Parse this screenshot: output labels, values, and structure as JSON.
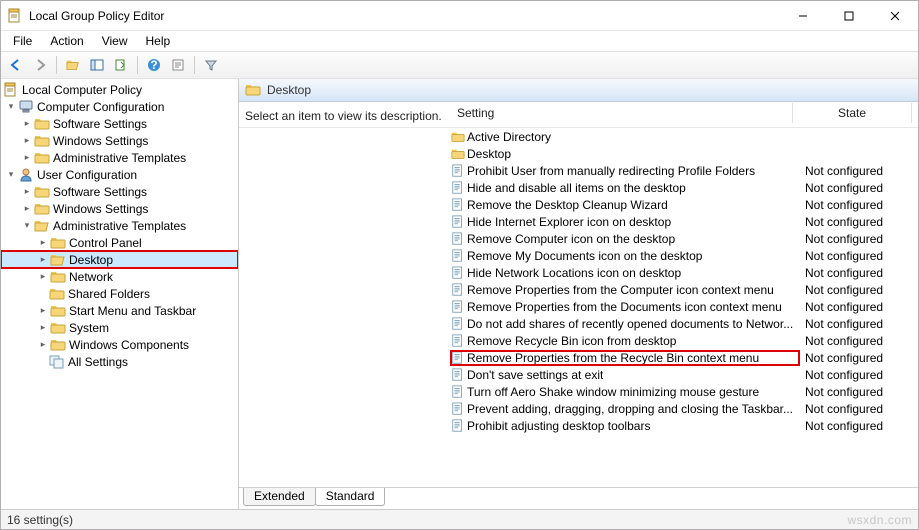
{
  "window": {
    "title": "Local Group Policy Editor"
  },
  "menubar": {
    "items": [
      "File",
      "Action",
      "View",
      "Help"
    ]
  },
  "tree": {
    "root": "Local Computer Policy",
    "computer_config": "Computer Configuration",
    "cc_software": "Software Settings",
    "cc_windows": "Windows Settings",
    "cc_admin": "Administrative Templates",
    "user_config": "User Configuration",
    "uc_software": "Software Settings",
    "uc_windows": "Windows Settings",
    "uc_admin": "Administrative Templates",
    "control_panel": "Control Panel",
    "desktop": "Desktop",
    "network": "Network",
    "shared": "Shared Folders",
    "startmenu": "Start Menu and Taskbar",
    "system": "System",
    "wincomp": "Windows Components",
    "allsettings": "All Settings"
  },
  "details": {
    "crumb": "Desktop",
    "description_prompt": "Select an item to view its description.",
    "col_setting": "Setting",
    "col_state": "State",
    "items": [
      {
        "type": "folder",
        "name": "Active Directory",
        "state": ""
      },
      {
        "type": "folder",
        "name": "Desktop",
        "state": ""
      },
      {
        "type": "policy",
        "name": "Prohibit User from manually redirecting Profile Folders",
        "state": "Not configured"
      },
      {
        "type": "policy",
        "name": "Hide and disable all items on the desktop",
        "state": "Not configured"
      },
      {
        "type": "policy",
        "name": "Remove the Desktop Cleanup Wizard",
        "state": "Not configured"
      },
      {
        "type": "policy",
        "name": "Hide Internet Explorer icon on desktop",
        "state": "Not configured"
      },
      {
        "type": "policy",
        "name": "Remove Computer icon on the desktop",
        "state": "Not configured"
      },
      {
        "type": "policy",
        "name": "Remove My Documents icon on the desktop",
        "state": "Not configured"
      },
      {
        "type": "policy",
        "name": "Hide Network Locations icon on desktop",
        "state": "Not configured"
      },
      {
        "type": "policy",
        "name": "Remove Properties from the Computer icon context menu",
        "state": "Not configured"
      },
      {
        "type": "policy",
        "name": "Remove Properties from the Documents icon context menu",
        "state": "Not configured"
      },
      {
        "type": "policy",
        "name": "Do not add shares of recently opened documents to Networ...",
        "state": "Not configured"
      },
      {
        "type": "policy",
        "name": "Remove Recycle Bin icon from desktop",
        "state": "Not configured"
      },
      {
        "type": "policy",
        "name": "Remove Properties from the Recycle Bin context menu",
        "state": "Not configured",
        "highlight": true
      },
      {
        "type": "policy",
        "name": "Don't save settings at exit",
        "state": "Not configured"
      },
      {
        "type": "policy",
        "name": "Turn off Aero Shake window minimizing mouse gesture",
        "state": "Not configured"
      },
      {
        "type": "policy",
        "name": "Prevent adding, dragging, dropping and closing the Taskbar...",
        "state": "Not configured"
      },
      {
        "type": "policy",
        "name": "Prohibit adjusting desktop toolbars",
        "state": "Not configured"
      }
    ]
  },
  "tabs": {
    "extended": "Extended",
    "standard": "Standard"
  },
  "statusbar": {
    "count": "16 setting(s)"
  },
  "watermark": "wsxdn.com"
}
